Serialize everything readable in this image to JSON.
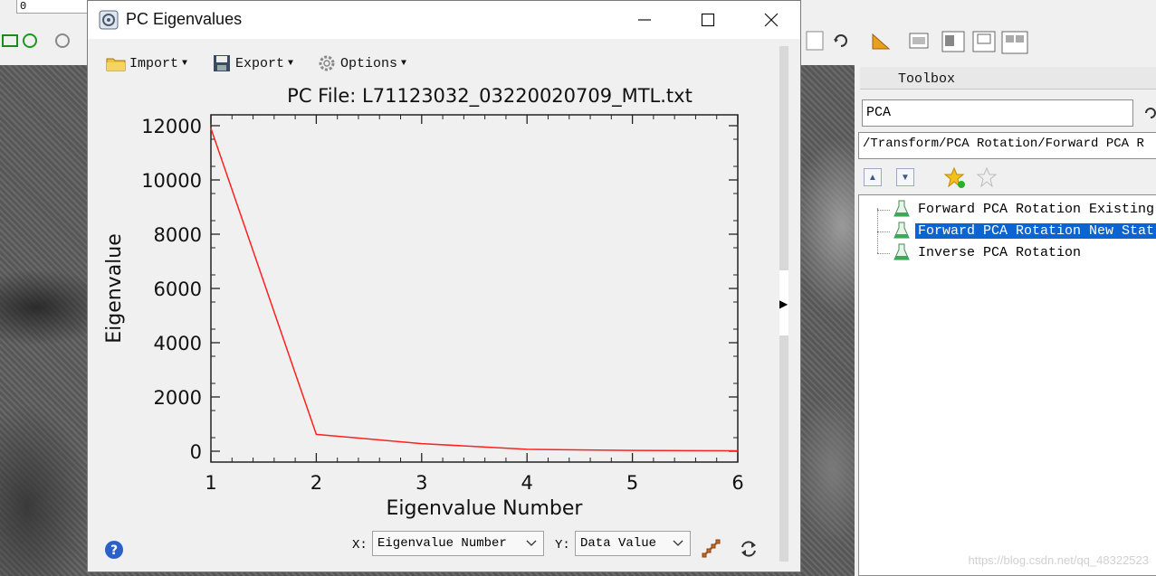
{
  "background_window": {
    "top_combo_value": "0"
  },
  "toolbox": {
    "title": "Toolbox",
    "search_value": "PCA",
    "path": "/Transform/PCA Rotation/Forward PCA R",
    "items": [
      {
        "label": "Forward PCA Rotation Existing",
        "selected": false
      },
      {
        "label": "Forward PCA Rotation New Stat",
        "selected": true
      },
      {
        "label": "Inverse PCA Rotation",
        "selected": false
      }
    ],
    "icons": {
      "fav_add": "star-add-icon",
      "fav": "star-icon",
      "up": "collapse-icon",
      "down": "expand-icon"
    }
  },
  "dialog": {
    "title": "PC Eigenvalues",
    "menu": {
      "import": "Import",
      "export": "Export",
      "options": "Options"
    },
    "controls": {
      "x_label": "X:",
      "x_value": "Eigenvalue Number",
      "y_label": "Y:",
      "y_value": "Data Value"
    }
  },
  "watermark": "https://blog.csdn.net/qq_48322523",
  "chart_data": {
    "type": "line",
    "title": "PC File: L71123032_03220020709_MTL.txt",
    "xlabel": "Eigenvalue Number",
    "ylabel": "Eigenvalue",
    "x": [
      1,
      2,
      3,
      4,
      5,
      6
    ],
    "series": [
      {
        "values": [
          11900,
          620,
          280,
          70,
          30,
          15
        ],
        "color": "#ff2020"
      }
    ],
    "xlim": [
      1,
      6
    ],
    "ylim": [
      -400,
      12400
    ],
    "xticks": [
      1,
      2,
      3,
      4,
      5,
      6
    ],
    "yticks": [
      0,
      2000,
      4000,
      6000,
      8000,
      10000,
      12000
    ],
    "grid": false,
    "legend": "none"
  }
}
